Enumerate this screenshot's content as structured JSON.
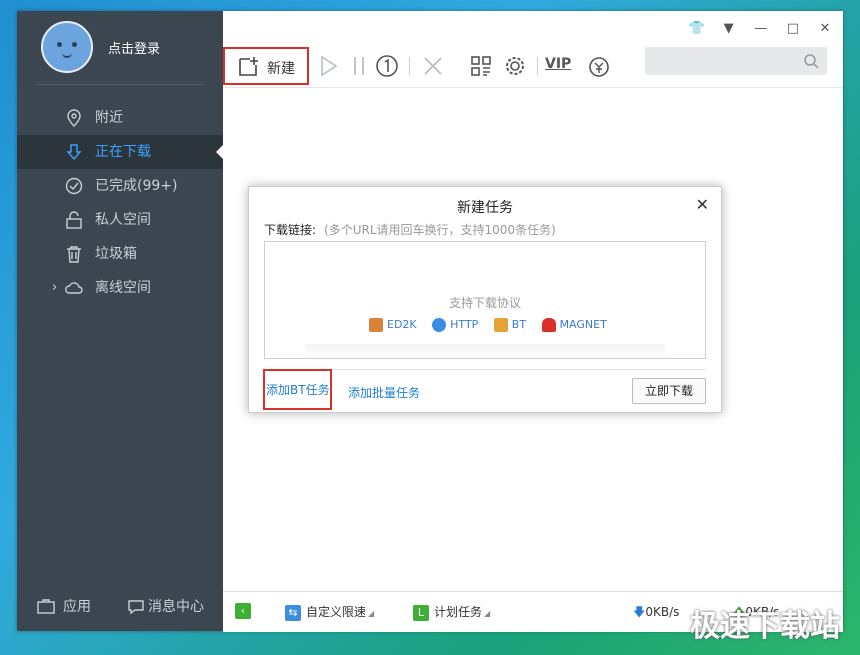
{
  "user": {
    "login_label": "点击登录"
  },
  "sidebar": {
    "items": [
      {
        "label": "附近",
        "icon": "location-icon"
      },
      {
        "label": "正在下载",
        "icon": "download-arrow-icon"
      },
      {
        "label": "已完成(99+)",
        "icon": "check-circle-icon"
      },
      {
        "label": "私人空间",
        "icon": "lock-icon"
      },
      {
        "label": "垃圾箱",
        "icon": "trash-icon"
      },
      {
        "label": "离线空间",
        "icon": "cloud-icon"
      }
    ],
    "active_index": 1,
    "bottom": {
      "apps": "应用",
      "messages": "消息中心"
    }
  },
  "toolbar": {
    "new_label": "新建",
    "vip_label": "VIP"
  },
  "search": {
    "placeholder": ""
  },
  "statusbar": {
    "speed_limit": "自定义限速",
    "schedule": "计划任务",
    "down_speed": "0KB/s",
    "up_speed": "0KB/s"
  },
  "dialog": {
    "title": "新建任务",
    "url_label": "下载链接:",
    "url_hint": "(多个URL请用回车换行，支持1000条任务)",
    "protocols_title": "支持下载协议",
    "protocols": [
      "ED2K",
      "HTTP",
      "BT",
      "MAGNET"
    ],
    "add_bt": "添加BT任务",
    "add_batch": "添加批量任务",
    "download_now": "立即下载"
  },
  "watermark": "极速下载站",
  "colors": {
    "accent": "#3aa3ff",
    "sidebar": "#3c4650",
    "highlight": "#d9302a"
  }
}
